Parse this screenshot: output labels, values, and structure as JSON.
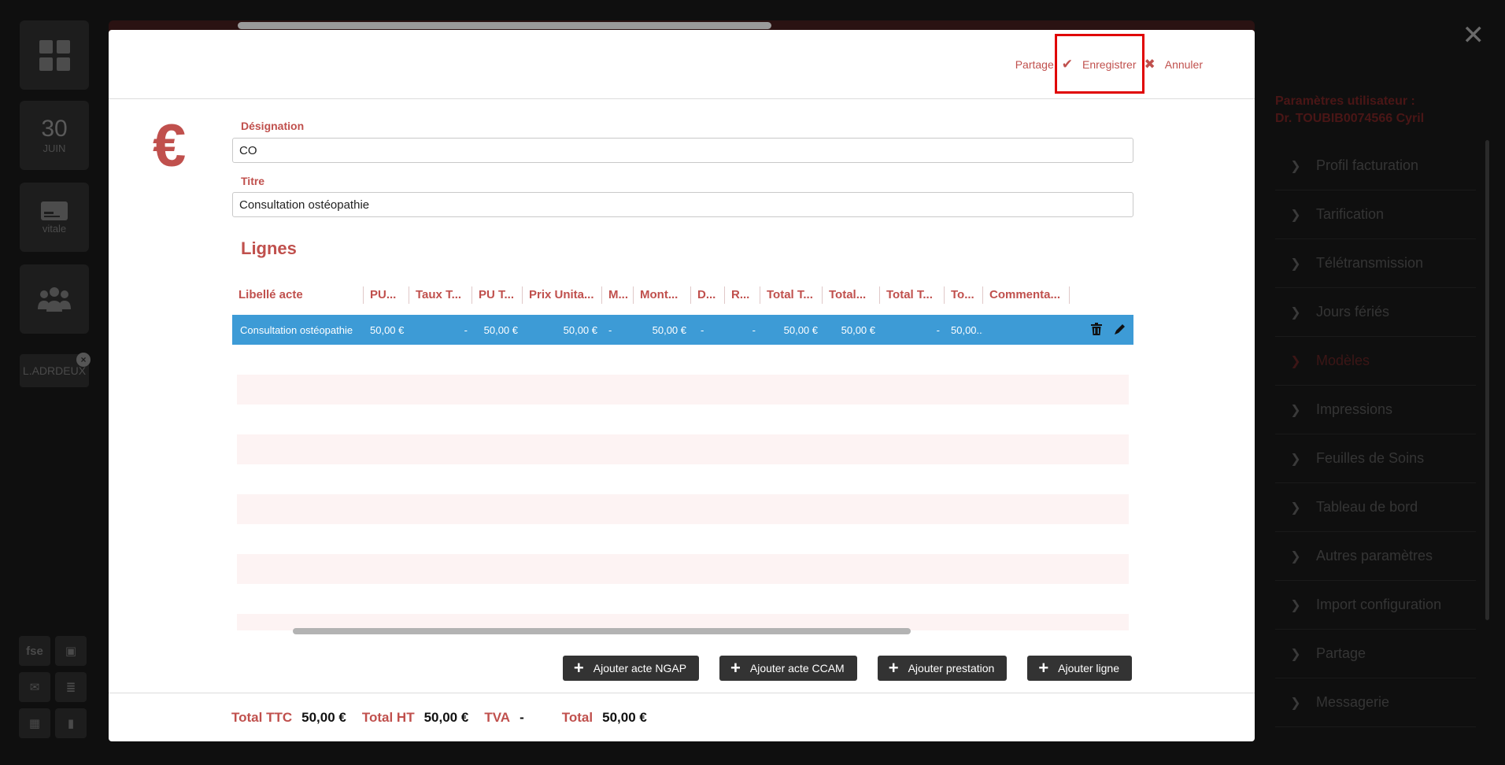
{
  "left_nav": {
    "dashboard_icon": "dashboard-grid-icon",
    "date_day": "30",
    "date_month": "JUIN",
    "vitale_label": "vitale",
    "patient_tab": "L.ADRDEUX",
    "fse_label": "fse"
  },
  "modal": {
    "header": {
      "share_label": "Partage",
      "save_label": "Enregistrer",
      "cancel_label": "Annuler"
    },
    "icon": "€",
    "designation": {
      "label": "Désignation",
      "value": "CO"
    },
    "titre": {
      "label": "Titre",
      "value": "Consultation ostéopathie"
    },
    "lignes_title": "Lignes",
    "table": {
      "columns": [
        "Libellé acte",
        "PU...",
        "Taux T...",
        "PU T...",
        "Prix Unita...",
        "M...",
        "Mont...",
        "D...",
        "R...",
        "Total T...",
        "Total...",
        "Total T...",
        "To...",
        "Commenta..."
      ],
      "row": [
        "Consultation ostéopathie",
        "50,00 €",
        "-",
        "50,00 €",
        "50,00 €",
        "-",
        "50,00 €",
        "-",
        "-",
        "50,00 €",
        "50,00 €",
        "-",
        "50,00...",
        ""
      ]
    },
    "buttons": {
      "ngap": "Ajouter acte NGAP",
      "ccam": "Ajouter acte CCAM",
      "prestation": "Ajouter prestation",
      "ligne": "Ajouter ligne"
    },
    "footer": {
      "ttc_label": "Total TTC",
      "ttc_value": "50,00 €",
      "ht_label": "Total HT",
      "ht_value": "50,00 €",
      "tva_label": "TVA",
      "tva_value": "-",
      "total_label": "Total",
      "total_value": "50,00 €"
    }
  },
  "settings": {
    "title_line1": "Paramètres utilisateur :",
    "title_line2": "Dr. TOUBIB0074566 Cyril",
    "items": [
      "Profil facturation",
      "Tarification",
      "Télétransmission",
      "Jours fériés",
      "Modèles",
      "Impressions",
      "Feuilles de Soins",
      "Tableau de bord",
      "Autres paramètres",
      "Import configuration",
      "Partage",
      "Messagerie"
    ]
  },
  "colors": {
    "accent": "#c0504d",
    "selected_row": "#3d9bd6",
    "button_dark": "#333333"
  }
}
